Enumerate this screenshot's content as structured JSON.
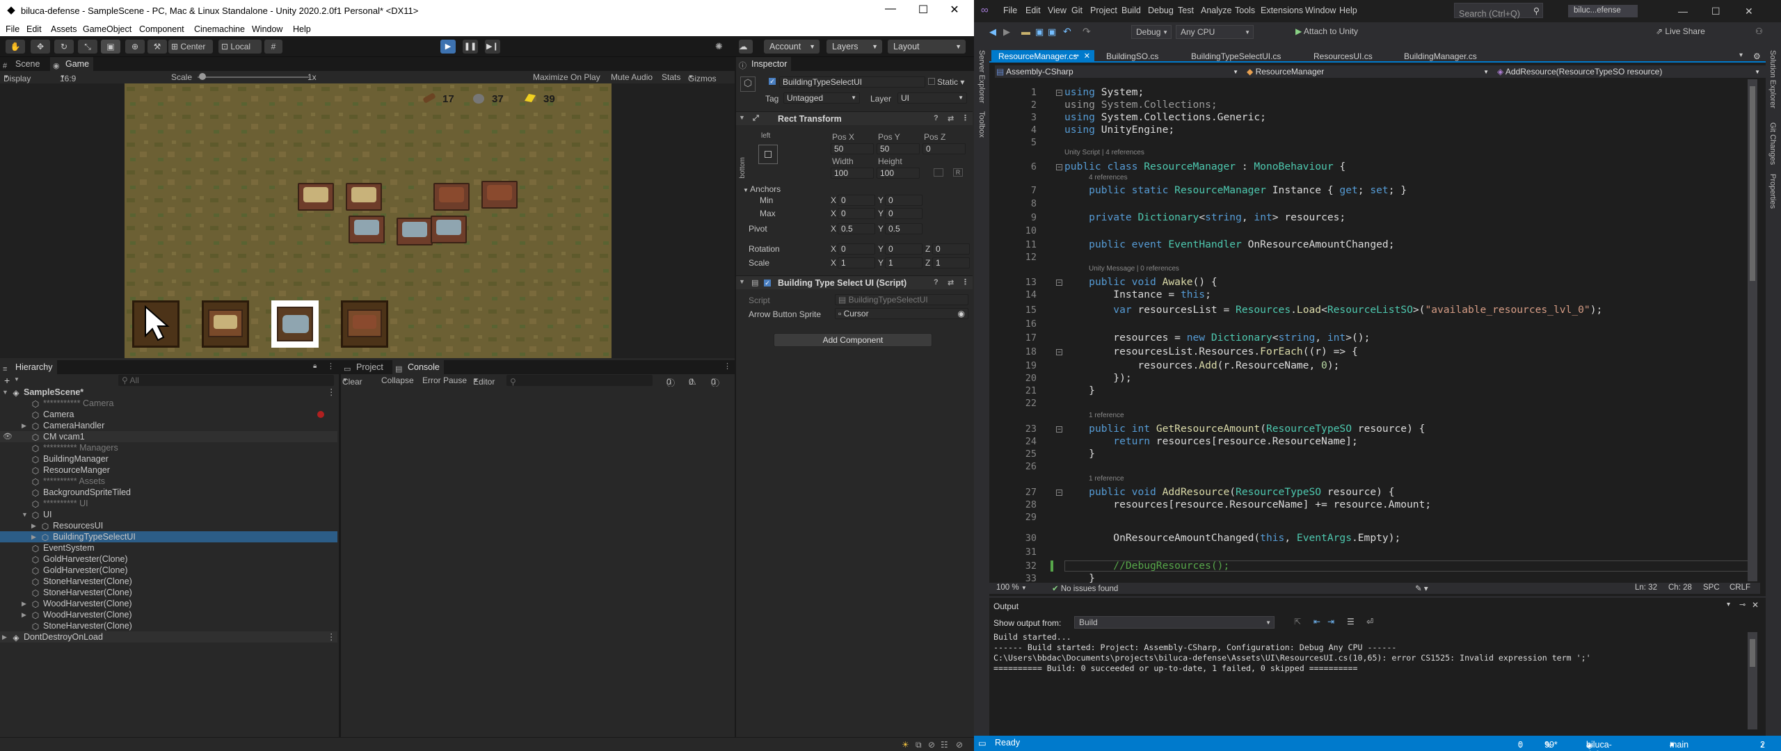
{
  "unity": {
    "title": "biluca-defense - SampleScene - PC, Mac & Linux Standalone - Unity 2020.2.0f1 Personal* <DX11>",
    "menu": [
      "File",
      "Edit",
      "Assets",
      "GameObject",
      "Component",
      "Cinemachine",
      "Window",
      "Help"
    ],
    "toolbar": {
      "center": "Center",
      "local": "Local",
      "account": "Account",
      "layers": "Layers",
      "layout": "Layout"
    },
    "scene_tab": "Scene",
    "game_tab": "Game",
    "game_bar": {
      "display": "Display 1",
      "aspect": "16:9 Aspect",
      "scale_label": "Scale",
      "scale_value": "1x",
      "maximize": "Maximize On Play",
      "mute": "Mute Audio",
      "stats": "Stats",
      "gizmos": "Gizmos"
    },
    "hud": {
      "wood": "17",
      "stone": "37",
      "gold": "39"
    },
    "hierarchy": {
      "tab": "Hierarchy",
      "search": "All",
      "items": [
        {
          "label": "SampleScene*",
          "indent": 0,
          "kind": "scene"
        },
        {
          "label": "*********** Camera",
          "indent": 1,
          "kind": "dim"
        },
        {
          "label": "Camera",
          "indent": 1,
          "kind": "obj"
        },
        {
          "label": "CameraHandler",
          "indent": 1,
          "kind": "obj",
          "arrow": true
        },
        {
          "label": "CM vcam1",
          "indent": 1,
          "kind": "obj",
          "hl": true
        },
        {
          "label": "********** Managers",
          "indent": 1,
          "kind": "dim"
        },
        {
          "label": "BuildingManager",
          "indent": 1,
          "kind": "obj"
        },
        {
          "label": "ResourceManger",
          "indent": 1,
          "kind": "obj"
        },
        {
          "label": "********** Assets",
          "indent": 1,
          "kind": "dim"
        },
        {
          "label": "BackgroundSpriteTiled",
          "indent": 1,
          "kind": "obj"
        },
        {
          "label": "********** UI",
          "indent": 1,
          "kind": "dim"
        },
        {
          "label": "UI",
          "indent": 1,
          "kind": "obj",
          "open": true
        },
        {
          "label": "ResourcesUI",
          "indent": 2,
          "kind": "obj",
          "arrow": true
        },
        {
          "label": "BuildingTypeSelectUI",
          "indent": 2,
          "kind": "obj",
          "arrow": true,
          "sel": true
        },
        {
          "label": "EventSystem",
          "indent": 1,
          "kind": "obj"
        },
        {
          "label": "GoldHarvester(Clone)",
          "indent": 1,
          "kind": "obj"
        },
        {
          "label": "GoldHarvester(Clone)",
          "indent": 1,
          "kind": "obj"
        },
        {
          "label": "StoneHarvester(Clone)",
          "indent": 1,
          "kind": "obj"
        },
        {
          "label": "StoneHarvester(Clone)",
          "indent": 1,
          "kind": "obj"
        },
        {
          "label": "WoodHarvester(Clone)",
          "indent": 1,
          "kind": "obj",
          "arrow": true
        },
        {
          "label": "WoodHarvester(Clone)",
          "indent": 1,
          "kind": "obj",
          "arrow": true
        },
        {
          "label": "StoneHarvester(Clone)",
          "indent": 1,
          "kind": "obj"
        },
        {
          "label": "DontDestroyOnLoad",
          "indent": 0,
          "kind": "scene2"
        }
      ]
    },
    "console": {
      "project_tab": "Project",
      "console_tab": "Console",
      "clear": "Clear",
      "collapse": "Collapse",
      "error_pause": "Error Pause",
      "editor": "Editor",
      "c0": "0",
      "c1": "0",
      "c2": "0"
    },
    "inspector": {
      "tab": "Inspector",
      "object_name": "BuildingTypeSelectUI",
      "static": "Static",
      "tag_label": "Tag",
      "tag": "Untagged",
      "layer_label": "Layer",
      "layer": "UI",
      "rect_transform": "Rect Transform",
      "left": "left",
      "bottom": "bottom",
      "posx_l": "Pos X",
      "posy_l": "Pos Y",
      "posz_l": "Pos Z",
      "posx": "50",
      "posy": "50",
      "posz": "0",
      "width_l": "Width",
      "height_l": "Height",
      "width": "100",
      "height": "100",
      "anchors": "Anchors",
      "min": "Min",
      "max": "Max",
      "pivot": "Pivot",
      "rotation": "Rotation",
      "scale": "Scale",
      "x": "X",
      "y": "Y",
      "z": "Z",
      "min_x": "0",
      "min_y": "0",
      "max_x": "0",
      "max_y": "0",
      "piv_x": "0.5",
      "piv_y": "0.5",
      "rot_x": "0",
      "rot_y": "0",
      "rot_z": "0",
      "sc_x": "1",
      "sc_y": "1",
      "sc_z": "1",
      "script_comp": "Building Type Select UI (Script)",
      "script_l": "Script",
      "script_v": "BuildingTypeSelectUI",
      "arrow_l": "Arrow Button Sprite",
      "arrow_v": "Cursor",
      "add_component": "Add Component"
    }
  },
  "vs": {
    "menu": [
      "File",
      "Edit",
      "View",
      "Git",
      "Project",
      "Build",
      "Debug",
      "Test",
      "Analyze",
      "Tools",
      "Extensions",
      "Window",
      "Help"
    ],
    "search": "Search (Ctrl+Q)",
    "project_name": "biluc...efense",
    "toolbar": {
      "config": "Debug",
      "platform": "Any CPU",
      "attach": "Attach to Unity",
      "live_share": "Live Share"
    },
    "tabs": [
      "ResourceManager.cs",
      "BuildingSO.cs",
      "BuildingTypeSelectUI.cs",
      "ResourcesUI.cs",
      "BuildingManager.cs"
    ],
    "nav": {
      "project": "Assembly-CSharp",
      "class": "ResourceManager",
      "member": "AddResource(ResourceTypeSO resource)"
    },
    "codelens": {
      "c1": "Unity Script | 4 references",
      "c2": "4 references",
      "c3": "Unity Message | 0 references",
      "c4": "1 reference",
      "c5": "1 reference"
    },
    "editor_status": {
      "zoom": "100 %",
      "issues": "No issues found",
      "ln": "Ln: 32",
      "ch": "Ch: 28",
      "spc": "SPC",
      "crlf": "CRLF"
    },
    "output": {
      "title": "Output",
      "show_from": "Show output from:",
      "source": "Build",
      "lines": [
        "Build started...",
        "------ Build started: Project: Assembly-CSharp, Configuration: Debug Any CPU ------",
        "C:\\Users\\bbdac\\Documents\\projects\\biluca-defense\\Assets\\UI\\ResourcesUI.cs(10,65): error CS1525: Invalid expression term ';'",
        "========== Build: 0 succeeded or up-to-date, 1 failed, 0 skipped =========="
      ]
    },
    "status": {
      "ready": "Ready",
      "up": "0",
      "pencil": "99*",
      "repo": "biluca-defense",
      "branch": "main",
      "notif": "2"
    },
    "side_tabs": [
      "Server Explorer",
      "Toolbox"
    ],
    "right_tabs": [
      "Solution Explorer",
      "Git Changes",
      "Properties"
    ]
  }
}
